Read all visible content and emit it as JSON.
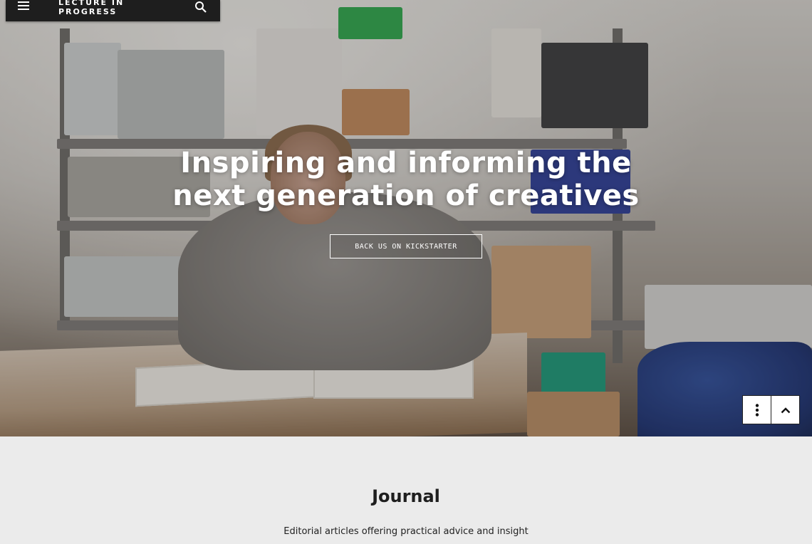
{
  "header": {
    "brand": "LECTURE IN PROGRESS",
    "menu_icon": "hamburger-menu-icon",
    "search_icon": "search-icon"
  },
  "hero": {
    "headline": "Inspiring and informing the next generation of creatives",
    "cta_label": "BACK US ON KICKSTARTER"
  },
  "floating_controls": {
    "more_icon": "vertical-dots-icon",
    "up_icon": "chevron-up-icon"
  },
  "journal": {
    "title": "Journal",
    "subtitle": "Editorial articles offering practical advice and insight"
  },
  "colors": {
    "topbar": "#1e1e1e",
    "section_background": "#ebebeb",
    "text_dark": "#1e1e1e"
  }
}
